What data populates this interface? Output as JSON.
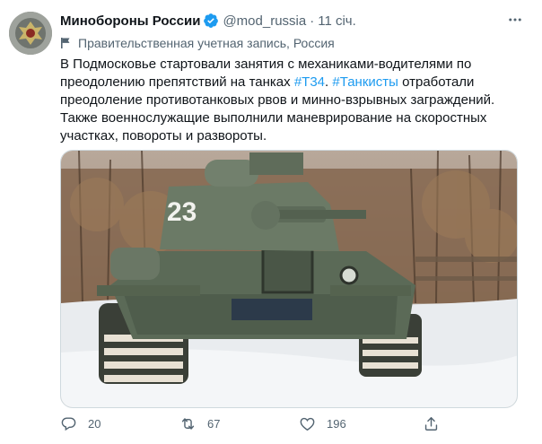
{
  "author": {
    "name": "Минобороны России",
    "handle": "@mod_russia",
    "separator": "·",
    "time": "11 січ."
  },
  "government_label": "Правительственная учетная запись, Россия",
  "tweet": {
    "l1": "В Подмосковье стартовали занятия с механиками-водителями по",
    "l2_pre": "преодолению препятствий на танках ",
    "l2_tag1": "#Т34",
    "l2_mid": ". ",
    "l2_tag2": "#Танкисты",
    "l2_post": " отработали",
    "l3": "преодоление противотанковых рвов и минно-взрывных заграждений.",
    "l4": "Также военнослужащие выполнили маневрирование на скоростных",
    "l5": "участках, повороты и развороты."
  },
  "media": {
    "turret_number": "23"
  },
  "actions": {
    "replies": "20",
    "retweets": "67",
    "likes": "196"
  },
  "colors": {
    "accent": "#1d9bf0",
    "secondary_text": "#536471",
    "primary_text": "#0f1419"
  }
}
